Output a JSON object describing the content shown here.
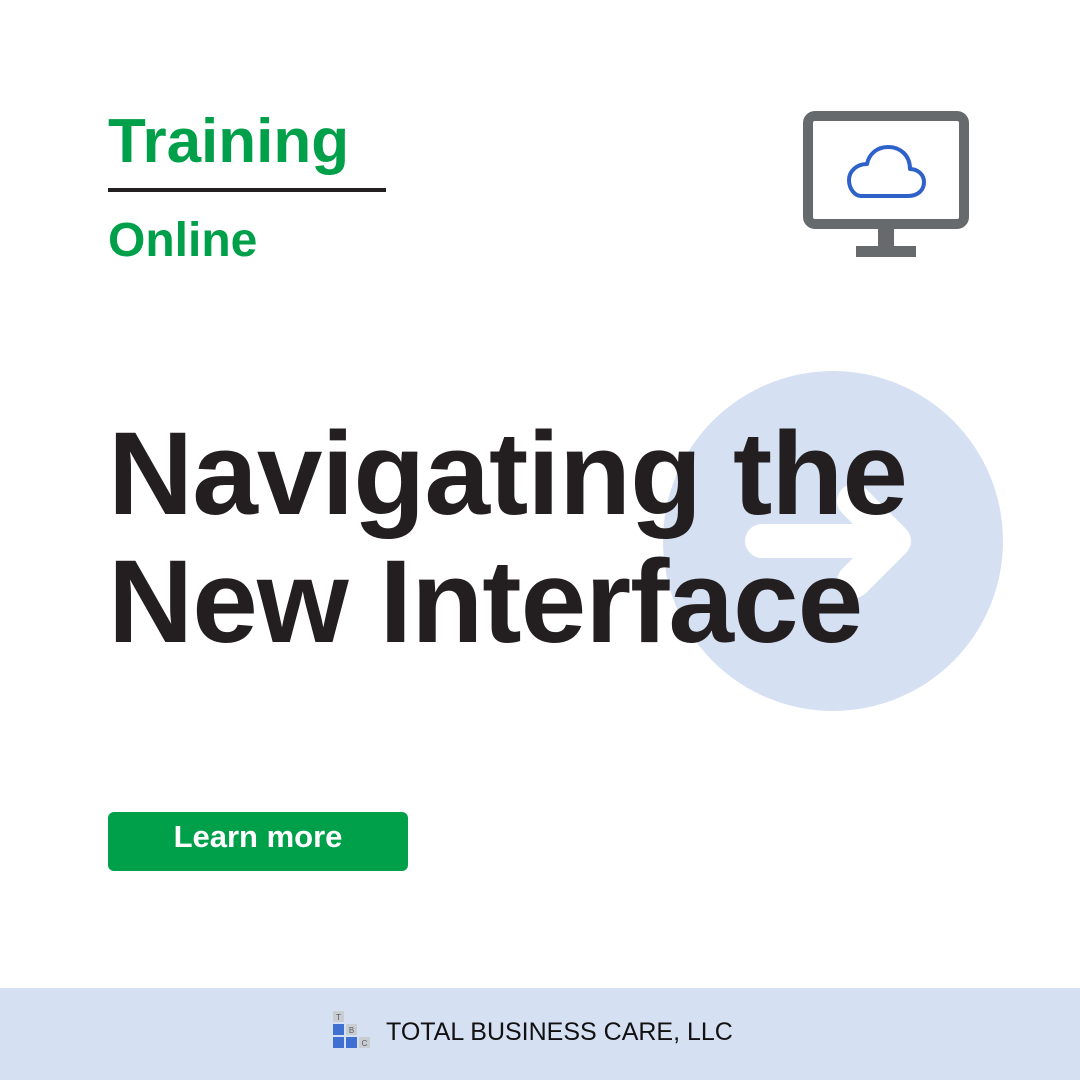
{
  "header": {
    "category": "Training",
    "format": "Online"
  },
  "headline": {
    "line1": "Navigating the",
    "line2": "New Interface"
  },
  "cta": {
    "label": "Learn more"
  },
  "footer": {
    "company": "TOTAL BUSINESS CARE, LLC",
    "logo_letters": [
      "T",
      "B",
      "C"
    ]
  },
  "icons": {
    "monitor": "computer-monitor-icon",
    "cloud": "cloud-icon",
    "arrow": "arrow-right-icon",
    "logo": "tbc-blocks-logo-icon"
  },
  "colors": {
    "brand_green": "#00a04a",
    "text_dark": "#231f20",
    "icon_gray": "#676a6d",
    "cloud_blue": "#2f62c9",
    "badge_blue": "#d6e0f3",
    "logo_blue": "#3f6fd0",
    "logo_gray": "#c9cdd2"
  }
}
